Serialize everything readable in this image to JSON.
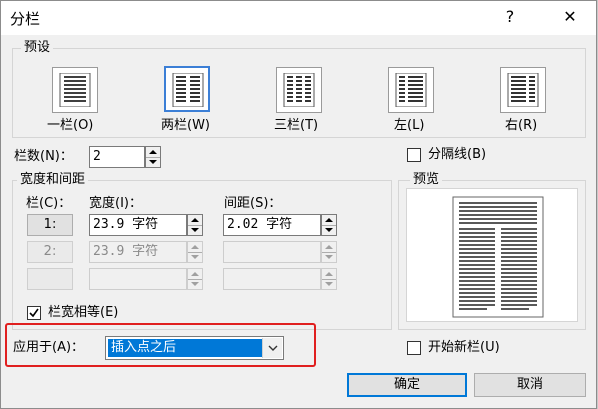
{
  "window": {
    "title": "分栏",
    "help": "?",
    "close": "✕"
  },
  "presets": {
    "group_label": "预设",
    "items": [
      {
        "label": "一栏(O)"
      },
      {
        "label": "两栏(W)"
      },
      {
        "label": "三栏(T)"
      },
      {
        "label": "左(L)"
      },
      {
        "label": "右(R)"
      }
    ]
  },
  "column_count": {
    "label": "栏数(N)：",
    "value": "2"
  },
  "separator": {
    "label": "分隔线(B)",
    "checked": false
  },
  "width_spacing": {
    "group_label": "宽度和间距",
    "col_header": "栏(C)：",
    "width_header": "宽度(I)：",
    "spacing_header": "间距(S)：",
    "rows": [
      {
        "col": "1:",
        "width": "23.9 字符",
        "spacing": "2.02 字符"
      },
      {
        "col": "2:",
        "width": "23.9 字符",
        "spacing": ""
      },
      {
        "col": "",
        "width": "",
        "spacing": ""
      }
    ]
  },
  "equal_width": {
    "label": "栏宽相等(E)",
    "checked": true
  },
  "preview": {
    "group_label": "预览"
  },
  "apply_to": {
    "label": "应用于(A)：",
    "value": "插入点之后"
  },
  "new_column": {
    "label": "开始新栏(U)",
    "checked": false
  },
  "buttons": {
    "ok": "确定",
    "cancel": "取消"
  },
  "colors": {
    "accent": "#0078d7",
    "highlight": "#e01f1f"
  }
}
